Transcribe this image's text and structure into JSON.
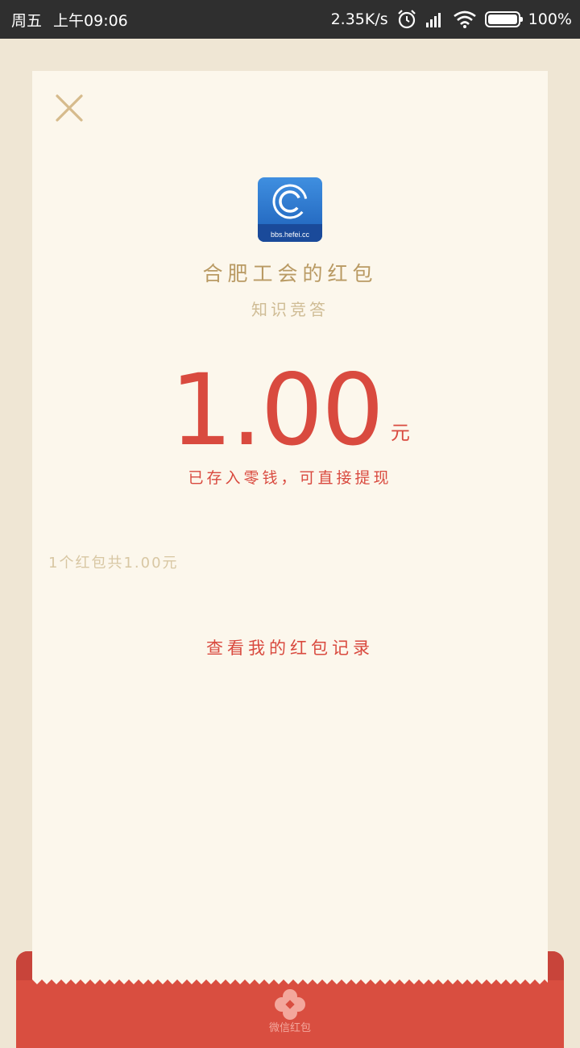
{
  "status_bar": {
    "day": "周五",
    "time": "上午09:06",
    "net_speed": "2.35K/s",
    "battery": "100%",
    "battery_level": 1.0
  },
  "card": {
    "logo_text": "bbs.hefei.cc",
    "sender": "合肥工会的红包",
    "subtitle": "知识竞答",
    "amount": "1.00",
    "unit": "元",
    "stored_note": "已存入零钱，可直接提现",
    "packet_count": "1个红包共1.00元",
    "records_link": "查看我的红包记录"
  },
  "footer": {
    "brand_text": "微信红包"
  },
  "colors": {
    "accent_red": "#d94a3f",
    "gold": "#b99a63",
    "paper": "#fcf7ec",
    "background": "#efe6d4"
  },
  "icons": [
    "close-icon",
    "alarm-icon",
    "signal-icon",
    "wifi-icon",
    "battery-icon",
    "logo-icon",
    "flower-icon"
  ]
}
